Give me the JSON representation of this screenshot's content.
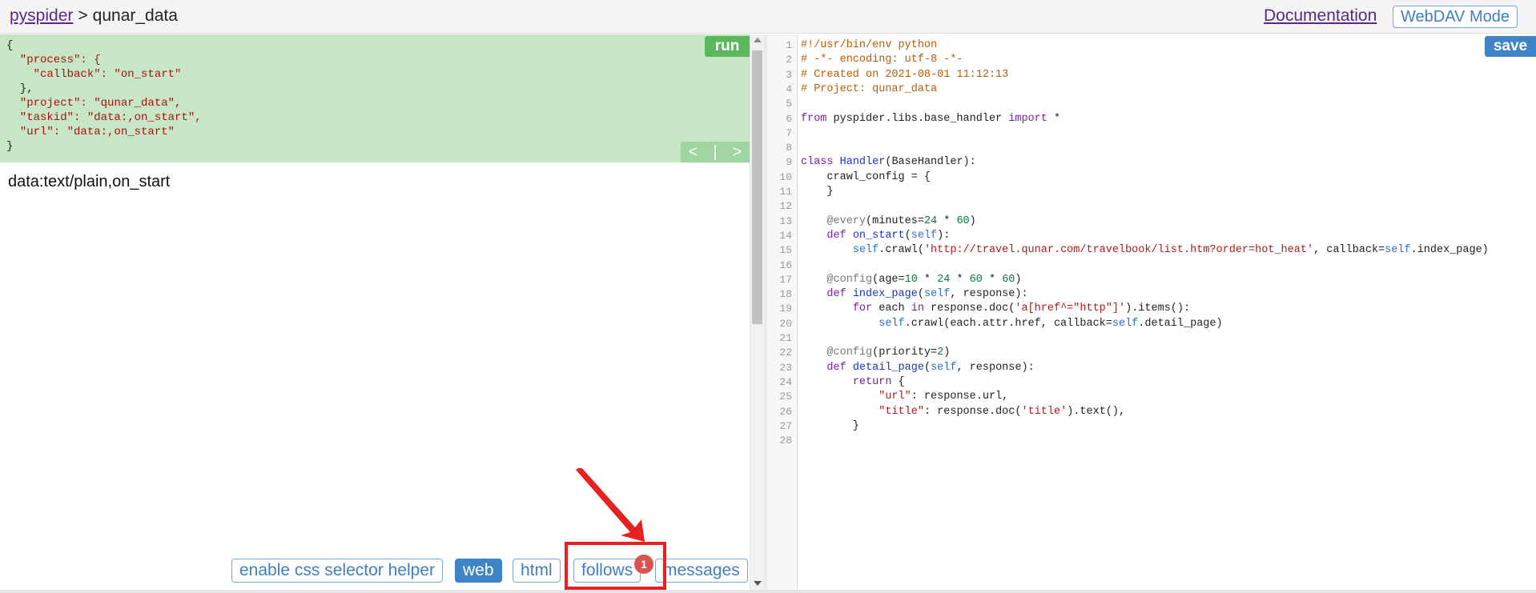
{
  "header": {
    "breadcrumb_root": "pyspider",
    "breadcrumb_sep": ">",
    "project_name": "qunar_data",
    "documentation_label": "Documentation",
    "webdav_label": "WebDAV Mode"
  },
  "task_panel": {
    "run_label": "run",
    "prev_label": "<",
    "divider": "|",
    "next_label": ">",
    "json_lines": [
      "{",
      "  \"process\": {",
      "    \"callback\": \"on_start\"",
      "  },",
      "  \"project\": \"qunar_data\",",
      "  \"taskid\": \"data:,on_start\",",
      "  \"url\": \"data:,on_start\"",
      "}"
    ]
  },
  "result_text": "data:text/plain,on_start",
  "bottom_tabs": {
    "css_helper": "enable css selector helper",
    "web": "web",
    "html": "html",
    "follows": "follows",
    "messages": "messages",
    "follows_badge": "1"
  },
  "editor": {
    "save_label": "save",
    "line_numbers": [
      "1",
      "2",
      "3",
      "4",
      "5",
      "6",
      "7",
      "8",
      "9",
      "10",
      "11",
      "12",
      "13",
      "14",
      "15",
      "16",
      "17",
      "18",
      "19",
      "20",
      "21",
      "22",
      "23",
      "24",
      "25",
      "26",
      "27",
      "28"
    ],
    "code_lines": [
      "#!/usr/bin/env python",
      "# -*- encoding: utf-8 -*-",
      "# Created on 2021-08-01 11:12:13",
      "# Project: qunar_data",
      "",
      "from pyspider.libs.base_handler import *",
      "",
      "",
      "class Handler(BaseHandler):",
      "    crawl_config = {",
      "    }",
      "",
      "    @every(minutes=24 * 60)",
      "    def on_start(self):",
      "        self.crawl('http://travel.qunar.com/travelbook/list.htm?order=hot_heat', callback=self.index_page)",
      "",
      "    @config(age=10 * 24 * 60 * 60)",
      "    def index_page(self, response):",
      "        for each in response.doc('a[href^=\"http\"]').items():",
      "            self.crawl(each.attr.href, callback=self.detail_page)",
      "",
      "    @config(priority=2)",
      "    def detail_page(self, response):",
      "        return {",
      "            \"url\": response.url,",
      "            \"title\": response.doc('title').text(),",
      "        }",
      ""
    ]
  },
  "colors": {
    "task_bg": "#c6e6c6",
    "run_green": "#5cb85c",
    "accent_blue": "#3f84c7",
    "annotation_red": "#e8201f",
    "badge_red": "#d9534f"
  }
}
